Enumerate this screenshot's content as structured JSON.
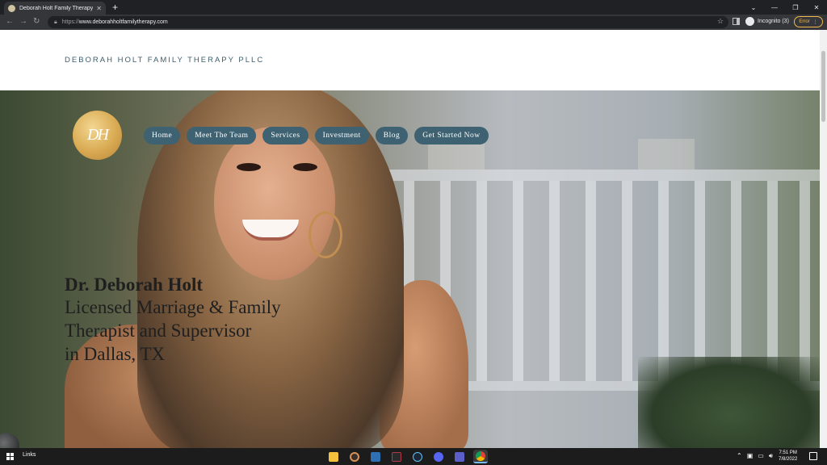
{
  "browser": {
    "tab_title": "Deborah Holt Family Therapy PLLC",
    "new_tab_label": "+",
    "url_scheme": "https://",
    "url_host": "www.deborahholtfamilytherapy.com",
    "incognito_label": "Incognito (3)",
    "error_label": "Error"
  },
  "site": {
    "title": "DEBORAH HOLT FAMILY THERAPY PLLC",
    "logo_text": "DH",
    "nav": [
      {
        "label": "Home"
      },
      {
        "label": "Meet The Team"
      },
      {
        "label": "Services"
      },
      {
        "label": "Investment"
      },
      {
        "label": "Blog"
      },
      {
        "label": "Get Started Now"
      }
    ],
    "hero": {
      "name": "Dr. Deborah Holt",
      "line1": "Licensed Marriage & Family",
      "line2": "Therapist and Supervisor",
      "line3": "in Dallas, TX"
    }
  },
  "taskbar": {
    "links_label": "Links",
    "time": "7:51 PM",
    "date": "7/8/2022"
  },
  "colors": {
    "nav_pill": "#3f6272",
    "site_title": "#3d5d6c",
    "logo_gold": "#d9aa52",
    "error_accent": "#f2b84b"
  }
}
